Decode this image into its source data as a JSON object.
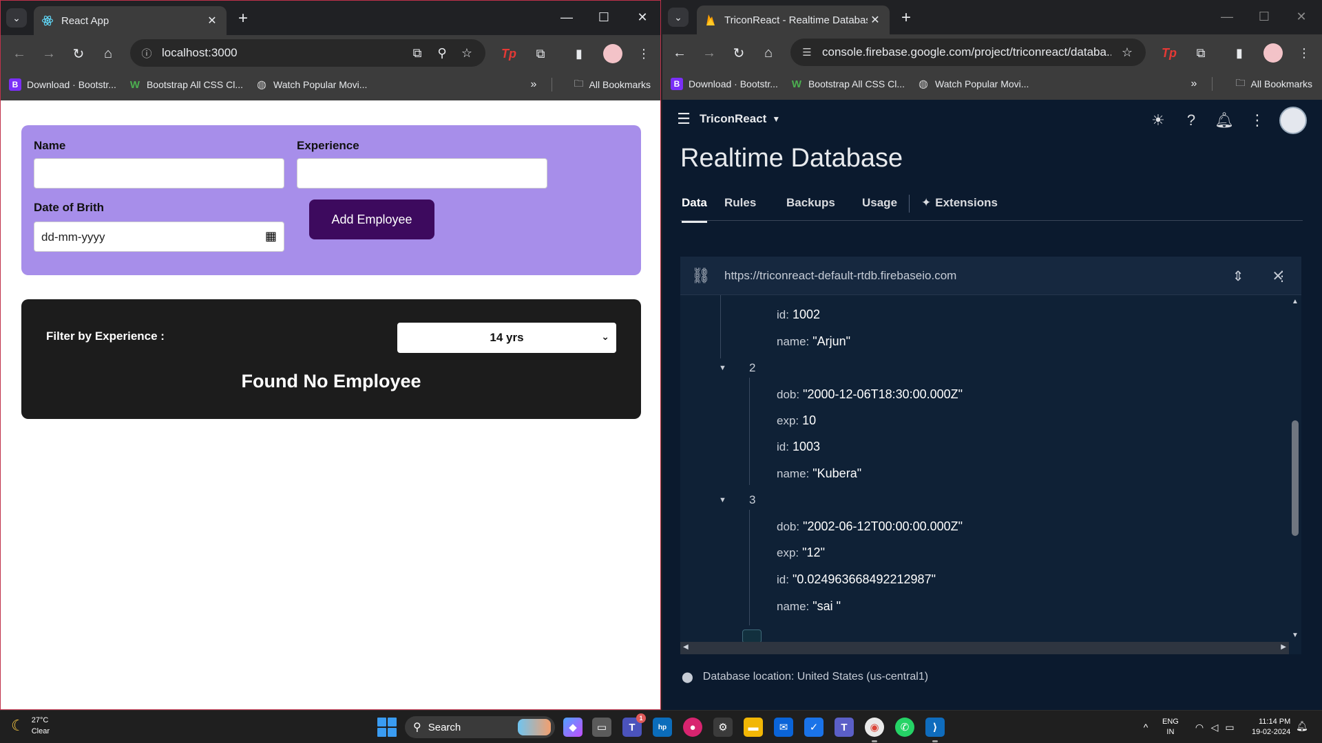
{
  "left_window": {
    "tab_title": "React App",
    "url": "localhost:3000",
    "bookmarks": [
      {
        "label": "Download · Bootstr..."
      },
      {
        "label": "Bootstrap All CSS Cl..."
      },
      {
        "label": "Watch Popular Movi..."
      }
    ],
    "all_bookmarks": "All Bookmarks"
  },
  "react_app": {
    "form": {
      "name_label": "Name",
      "experience_label": "Experience",
      "dob_label": "Date of Brith",
      "dob_placeholder": "dd-mm-yyyy",
      "add_button": "Add Employee"
    },
    "filter": {
      "label": "Filter by Experience :",
      "selected": "14 yrs",
      "message": "Found No Employee"
    }
  },
  "right_window": {
    "tab_title": "TriconReact - Realtime Database",
    "url": "console.firebase.google.com/project/triconreact/databa...",
    "bookmarks": [
      {
        "label": "Download · Bootstr..."
      },
      {
        "label": "Bootstrap All CSS Cl..."
      },
      {
        "label": "Watch Popular Movi..."
      }
    ],
    "all_bookmarks": "All Bookmarks"
  },
  "firebase": {
    "project": "TriconReact",
    "page_title": "Realtime Database",
    "tabs": [
      "Data",
      "Rules",
      "Backups",
      "Usage",
      "Extensions"
    ],
    "db_url": "https://triconreact-default-rtdb.firebaseio.com",
    "location": "Database location: United States (us-central1)",
    "tree": {
      "partial": [
        {
          "key": "id:",
          "value": "1002"
        },
        {
          "key": "name:",
          "value": "\"Arjun\""
        }
      ],
      "node2": {
        "index": "2",
        "fields": [
          {
            "key": "dob:",
            "value": "\"2000-12-06T18:30:00.000Z\""
          },
          {
            "key": "exp:",
            "value": "10"
          },
          {
            "key": "id:",
            "value": "1003"
          },
          {
            "key": "name:",
            "value": "\"Kubera\""
          }
        ]
      },
      "node3": {
        "index": "3",
        "fields": [
          {
            "key": "dob:",
            "value": "\"2002-06-12T00:00:00.000Z\""
          },
          {
            "key": "exp:",
            "value": "\"12\""
          },
          {
            "key": "id:",
            "value": "\"0.024963668492212987\""
          },
          {
            "key": "name:",
            "value": "\"sai \""
          }
        ]
      }
    }
  },
  "taskbar": {
    "temperature": "27°C",
    "weather": "Clear",
    "search": "Search",
    "teams_badge": "1",
    "lang_top": "ENG",
    "lang_bottom": "IN",
    "time": "11:14 PM",
    "date": "19-02-2024"
  },
  "colors": {
    "form_bg": "#a78eea",
    "button_bg": "#3d0a5e",
    "filter_bg": "#1c1c1c",
    "firebase_bg": "#0b1a2e"
  }
}
